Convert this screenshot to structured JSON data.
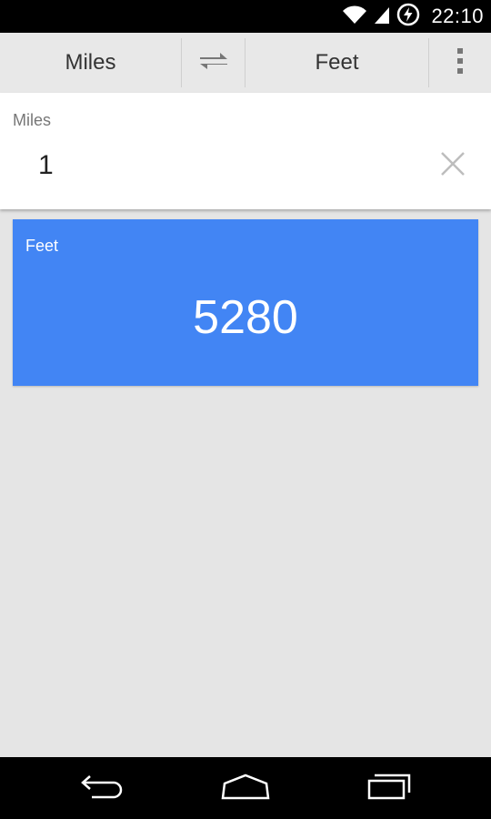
{
  "status_bar": {
    "time": "22:10",
    "icons": [
      "wifi-icon",
      "signal-icon",
      "battery-charging-icon"
    ]
  },
  "toolbar": {
    "from_unit": "Miles",
    "to_unit": "Feet",
    "swap_icon": "swap-arrows-icon",
    "menu_icon": "overflow-menu-icon"
  },
  "input": {
    "label": "Miles",
    "value": "1",
    "clear_icon": "close-icon"
  },
  "result": {
    "label": "Feet",
    "value": "5280",
    "color": "#4285f4"
  },
  "nav_bar": {
    "icons": [
      "back-icon",
      "home-icon",
      "recents-icon"
    ]
  }
}
